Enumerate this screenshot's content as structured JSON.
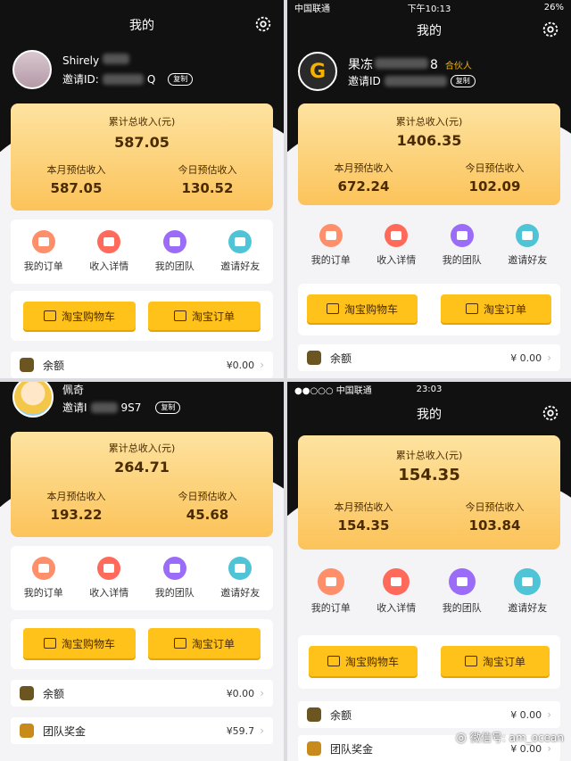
{
  "panels": [
    {
      "title": "我的",
      "username": "Shirely",
      "invite_label": "邀请ID:",
      "invite_code_suffix": "Q",
      "copy_label": "复制",
      "total_label": "累计总收入(元)",
      "total_value": "587.05",
      "month_label": "本月预估收入",
      "month_value": "587.05",
      "today_label": "今日预估收入",
      "today_value": "130.52",
      "menu": [
        "我的订单",
        "收入详情",
        "我的团队",
        "邀请好友"
      ],
      "btn_cart": "淘宝购物车",
      "btn_order": "淘宝订单",
      "rows": [
        {
          "label": "余额",
          "value": "¥0.00"
        }
      ]
    },
    {
      "status": {
        "carrier": "中国联通",
        "time": "下午10:13",
        "battery": "26%"
      },
      "title": "我的",
      "username": "果冻",
      "username_suffix": "8",
      "partner": "合伙人",
      "invite_label": "邀请ID",
      "copy_label": "复制",
      "total_label": "累计总收入(元)",
      "total_value": "1406.35",
      "month_label": "本月预估收入",
      "month_value": "672.24",
      "today_label": "今日预估收入",
      "today_value": "102.09",
      "menu": [
        "我的订单",
        "收入详情",
        "我的团队",
        "邀请好友"
      ],
      "btn_cart": "淘宝购物车",
      "btn_order": "淘宝订单",
      "rows": [
        {
          "label": "余额",
          "value": "¥ 0.00"
        }
      ]
    },
    {
      "username": "佩奇",
      "invite_label": "邀请I",
      "invite_code_suffix": "9S7",
      "copy_label": "复制",
      "total_label": "累计总收入(元)",
      "total_value": "264.71",
      "month_label": "本月预估收入",
      "month_value": "193.22",
      "today_label": "今日预估收入",
      "today_value": "45.68",
      "menu": [
        "我的订单",
        "收入详情",
        "我的团队",
        "邀请好友"
      ],
      "btn_cart": "淘宝购物车",
      "btn_order": "淘宝订单",
      "rows": [
        {
          "label": "余额",
          "value": "¥0.00"
        },
        {
          "label": "团队奖金",
          "value": "¥59.7"
        }
      ]
    },
    {
      "status": {
        "carrier": "●●○○○ 中国联通",
        "time": "23:03",
        "battery": ""
      },
      "title": "我的",
      "total_label": "累计总收入(元)",
      "total_value": "154.35",
      "month_label": "本月预估收入",
      "month_value": "154.35",
      "today_label": "今日预估收入",
      "today_value": "103.84",
      "menu": [
        "我的订单",
        "收入详情",
        "我的团队",
        "邀请好友"
      ],
      "btn_cart": "淘宝购物车",
      "btn_order": "淘宝订单",
      "rows": [
        {
          "label": "余额",
          "value": "¥ 0.00"
        },
        {
          "label": "团队奖金",
          "value": "¥ 0.00"
        }
      ]
    }
  ],
  "watermark": "微信号: am_ocean",
  "colors": {
    "accent": "#ffc21a",
    "card_top": "#fde3a0",
    "card_bottom": "#fcc35a",
    "header": "#111111"
  }
}
